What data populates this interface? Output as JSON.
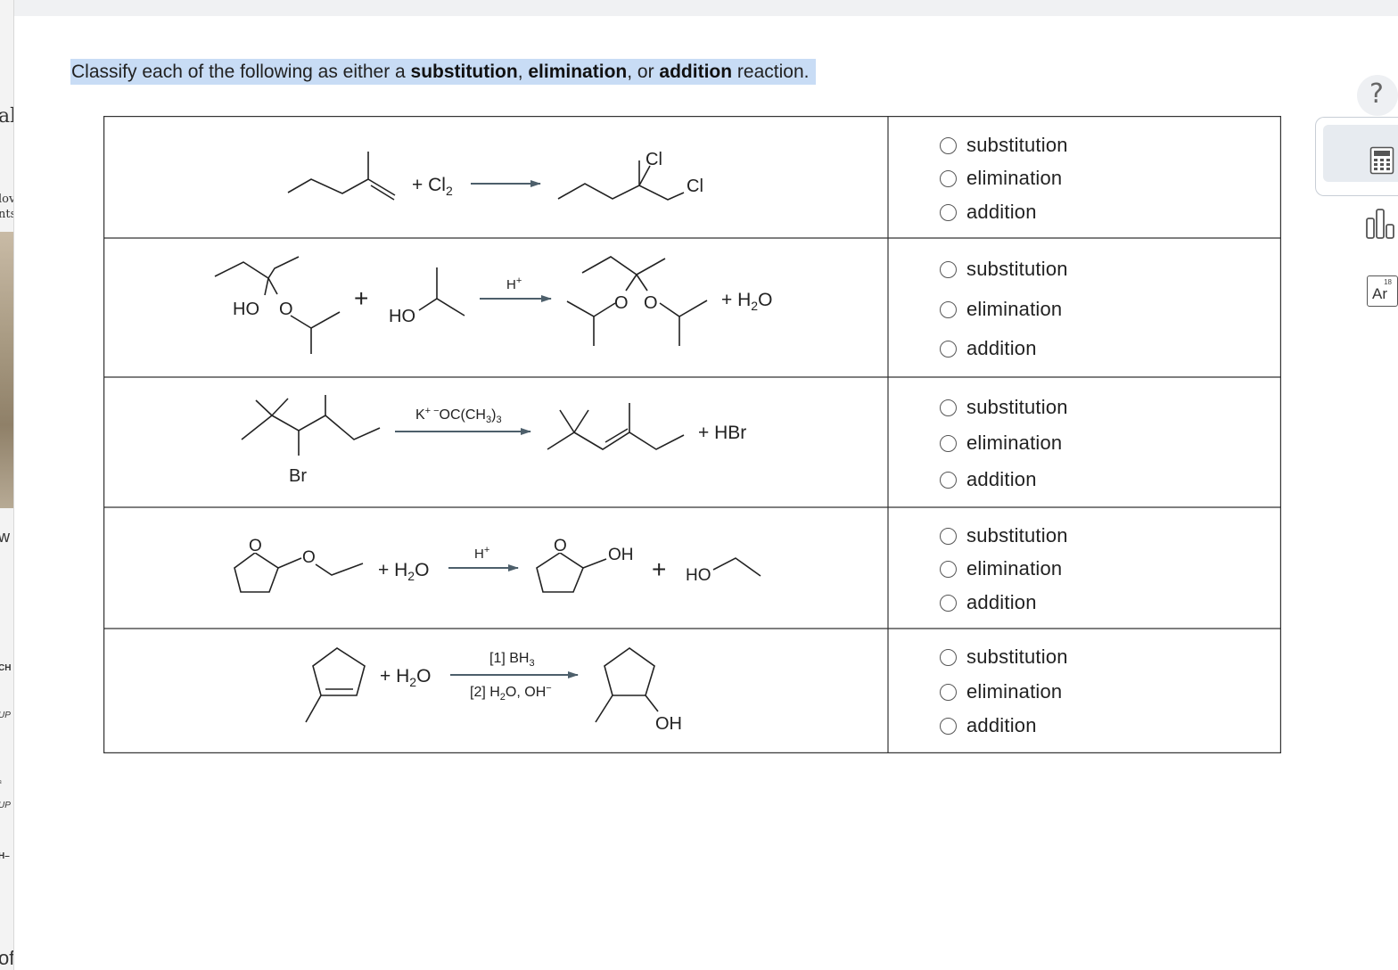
{
  "question": {
    "prefix": "Classify each of the following as either a ",
    "term1": "substitution",
    "sep1": ", ",
    "term2": "elimination",
    "sep2": ", or ",
    "term3": "addition",
    "suffix": " reaction."
  },
  "reactions": [
    {
      "reagent": "+ Cl",
      "reagent_sub": "2",
      "product_atoms": [
        "Cl",
        "Cl"
      ],
      "options": [
        "substitution",
        "elimination",
        "addition"
      ]
    },
    {
      "reactant_atoms": [
        "HO",
        "O"
      ],
      "plus": "+",
      "reagent2_atom": "HO",
      "condition": "H",
      "condition_sup": "+",
      "product_atoms": [
        "O",
        "O"
      ],
      "byproduct": "+ H",
      "byproduct_sub": "2",
      "byproduct_end": "O",
      "options": [
        "substitution",
        "elimination",
        "addition"
      ]
    },
    {
      "reactant_atom": "Br",
      "condition_a": "K",
      "condition_sup1": "+",
      "condition_sup2": "−",
      "condition_b": "OC(CH",
      "condition_sub": "3",
      "condition_c": ")",
      "condition_sub2": "3",
      "byproduct": "+ HBr",
      "options": [
        "substitution",
        "elimination",
        "addition"
      ]
    },
    {
      "reactant_atoms": [
        "O",
        "O"
      ],
      "reagent": "+ H",
      "reagent_sub": "2",
      "reagent_end": "O",
      "condition": "H",
      "condition_sup": "+",
      "product_atoms": [
        "O",
        "OH"
      ],
      "plus": "+",
      "byproduct_atom": "HO",
      "options": [
        "substitution",
        "elimination",
        "addition"
      ]
    },
    {
      "reagent": "+ H",
      "reagent_sub": "2",
      "reagent_end": "O",
      "condition1": "[1] BH",
      "condition1_sub": "3",
      "condition2a": "[2] H",
      "condition2_sub": "2",
      "condition2b": "O, OH",
      "condition2_sup": "−",
      "product_atom": "OH",
      "options": [
        "substitution",
        "elimination",
        "addition"
      ]
    }
  ],
  "tools": {
    "help": "?",
    "calculator_icon": "calculator-icon",
    "chart_icon": "bar-chart-icon",
    "periodic_icon": "periodic-table-icon",
    "periodic_number": "18",
    "periodic_symbol": "Ar"
  },
  "left_fragments": [
    "al",
    "lov",
    "nts",
    "w",
    "CH",
    "UP",
    "₃",
    "UP",
    "H–",
    "of"
  ],
  "colors": {
    "highlight": "#c8dcf5",
    "arrow": "#4d5f6b",
    "border": "#333333",
    "tool_bg": "#edf0f4"
  }
}
